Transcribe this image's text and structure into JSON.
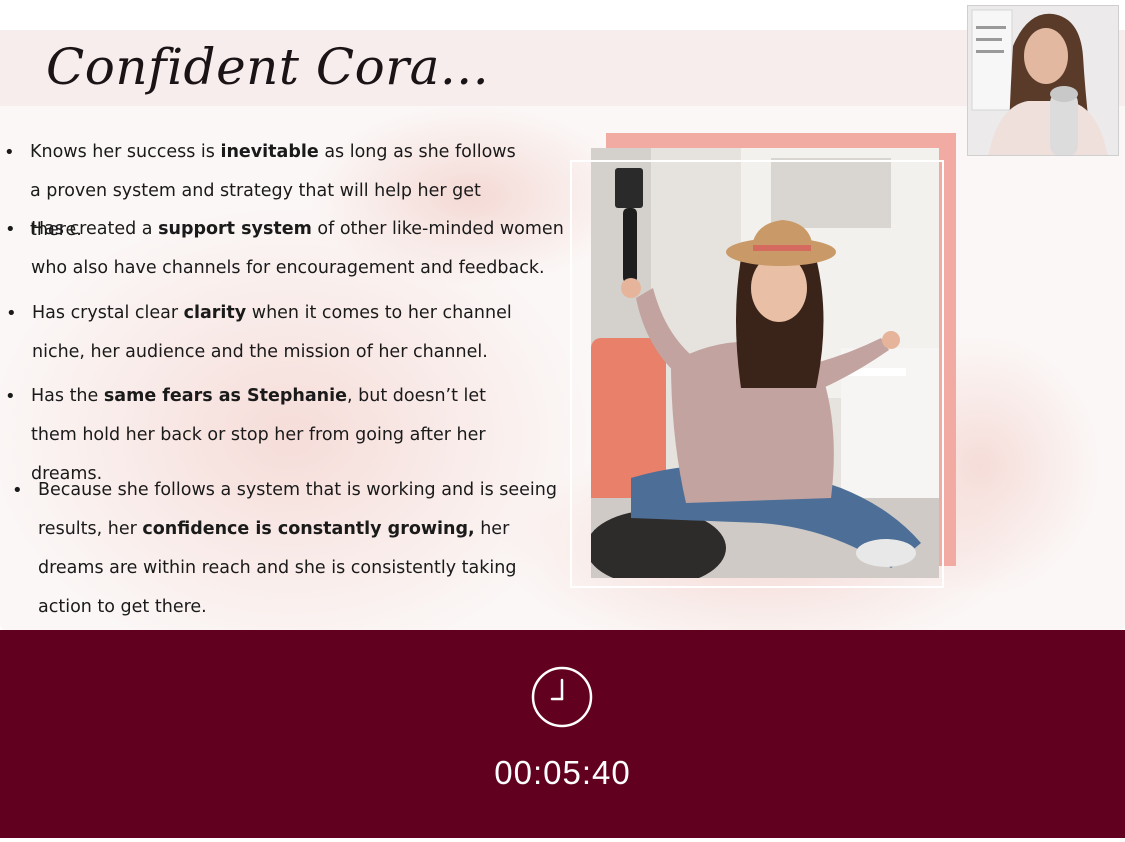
{
  "slide": {
    "title": "Confident Cora...",
    "bullets": [
      {
        "parts": [
          {
            "text": "Knows her success is ",
            "bold": false
          },
          {
            "text": "inevitable",
            "bold": true
          },
          {
            "text": " as long as she follows a proven system and strategy that will help her get there.",
            "bold": false
          }
        ]
      },
      {
        "parts": [
          {
            "text": "Has created a ",
            "bold": false
          },
          {
            "text": "support system",
            "bold": true
          },
          {
            "text": " of other like-minded women who also have channels for encouragement and feedback.",
            "bold": false
          }
        ]
      },
      {
        "parts": [
          {
            "text": "Has crystal clear ",
            "bold": false
          },
          {
            "text": "clarity",
            "bold": true
          },
          {
            "text": " when it comes to her channel niche, her audience and the mission of her channel.",
            "bold": false
          }
        ]
      },
      {
        "parts": [
          {
            "text": "Has the ",
            "bold": false
          },
          {
            "text": "same fears as Stephanie",
            "bold": true
          },
          {
            "text": ", but doesn’t let them hold her back or stop her from going after her dreams.",
            "bold": false
          }
        ]
      },
      {
        "parts": [
          {
            "text": "Because she follows a system that is working and is seeing results, her ",
            "bold": false
          },
          {
            "text": "confidence is constantly growing,",
            "bold": true
          },
          {
            "text": " her dreams are within reach and she is consistently taking action to get there.",
            "bold": false
          }
        ]
      }
    ],
    "bullet_glyph": "•",
    "photo_icon": "woman-vlogging-photo"
  },
  "webcam": {
    "icon": "presenter-video"
  },
  "timer": {
    "icon": "clock-icon",
    "value": "00:05:40"
  },
  "colors": {
    "timer_bar": "#620020",
    "photo_frame": "#f2aba3",
    "title_band": "#f7eded"
  }
}
